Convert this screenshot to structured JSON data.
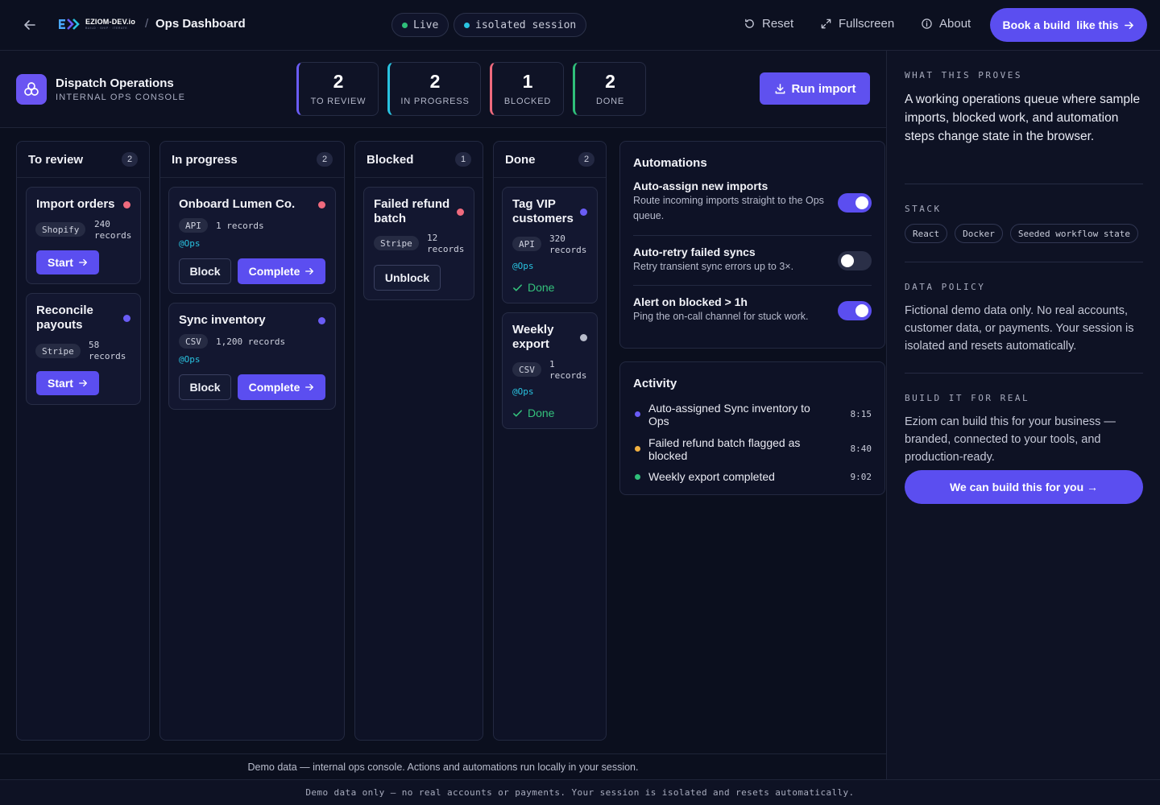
{
  "topbar": {
    "logo_name": "EZIOM-DEV.io",
    "logo_tagline": "BUILD · SHIP · ITERATE",
    "breadcrumb_sep": "/",
    "title": "Ops Dashboard",
    "pill_live": "Live",
    "pill_session": "isolated session",
    "reset": "Reset",
    "fullscreen": "Fullscreen",
    "about": "About",
    "book": "Book a build  like this",
    "colors": {
      "accent": "#5b4ef0",
      "live": "#2fbf7a",
      "session": "#29c3e0"
    }
  },
  "header": {
    "app_name": "Dispatch Operations",
    "app_sub": "INTERNAL OPS CONSOLE",
    "stats": [
      {
        "value": "2",
        "label": "TO REVIEW"
      },
      {
        "value": "2",
        "label": "IN PROGRESS"
      },
      {
        "value": "1",
        "label": "BLOCKED"
      },
      {
        "value": "2",
        "label": "DONE"
      }
    ],
    "run_import": "Run import"
  },
  "columns": {
    "to_review": {
      "title": "To review",
      "count": "2",
      "cards": [
        {
          "title": "Import orders",
          "source": "Shopify",
          "records_num": "240",
          "records_unit": "records",
          "action": "Start"
        },
        {
          "title": "Reconcile payouts",
          "source": "Stripe",
          "records_num": "58",
          "records_unit": "records",
          "action": "Start"
        }
      ]
    },
    "in_progress": {
      "title": "In progress",
      "count": "2",
      "cards": [
        {
          "title": "Onboard Lumen Co.",
          "source": "API",
          "records": "1 records",
          "owner": "@Ops",
          "block": "Block",
          "complete": "Complete"
        },
        {
          "title": "Sync inventory",
          "source": "CSV",
          "records": "1,200 records",
          "owner": "@Ops",
          "block": "Block",
          "complete": "Complete"
        }
      ]
    },
    "blocked": {
      "title": "Blocked",
      "count": "1",
      "cards": [
        {
          "title_line1": "Failed refund",
          "title_line2": "batch",
          "source": "Stripe",
          "records_num": "12",
          "records_unit": "records",
          "action": "Unblock"
        }
      ]
    },
    "done": {
      "title": "Done",
      "count": "2",
      "cards": [
        {
          "title_line1": "Tag VIP",
          "title_line2": "customers",
          "source": "API",
          "records_num": "320",
          "records_unit": "records",
          "owner": "@Ops",
          "status": "Done"
        },
        {
          "title_line1": "Weekly",
          "title_line2": "export",
          "source": "CSV",
          "records_num": "1",
          "records_unit": "records",
          "owner": "@Ops",
          "status": "Done"
        }
      ]
    }
  },
  "automations": {
    "title": "Automations",
    "items": [
      {
        "name": "Auto-assign new imports",
        "desc": "Route incoming imports straight to the Ops queue.",
        "enabled": true
      },
      {
        "name": "Auto-retry failed syncs",
        "desc": "Retry transient sync errors up to 3×.",
        "enabled": false
      },
      {
        "name": "Alert on blocked > 1h",
        "desc": "Ping the on-call channel for stuck work.",
        "enabled": true
      }
    ]
  },
  "activity": {
    "title": "Activity",
    "items": [
      {
        "text": "Auto-assigned Sync inventory to Ops",
        "time": "8:15",
        "color": "#6a5cf5"
      },
      {
        "text": "Failed refund batch flagged as blocked",
        "time": "8:40",
        "color": "#f0b040"
      },
      {
        "text": "Weekly export completed",
        "time": "9:02",
        "color": "#2fbf7a"
      }
    ]
  },
  "main_footer": "Demo data — internal ops console. Actions and automations run locally in your session.",
  "bottom_bar": "Demo data only — no real accounts or payments. Your session is isolated and resets automatically.",
  "sidebar": {
    "proves_label": "WHAT THIS PROVES",
    "proves_text": "A working operations queue where sample imports, blocked work, and automation steps change state in the browser.",
    "stack_label": "STACK",
    "stack": [
      "React",
      "Docker",
      "Seeded workflow state"
    ],
    "policy_label": "DATA POLICY",
    "policy_text": "Fictional demo data only. No real accounts, customer data, or payments. Your session is isolated and resets automatically.",
    "build_label": "BUILD IT FOR REAL",
    "build_text": "Eziom can build this for your business — branded, connected to your tools, and production-ready.",
    "cta": "We can build this for you →"
  }
}
